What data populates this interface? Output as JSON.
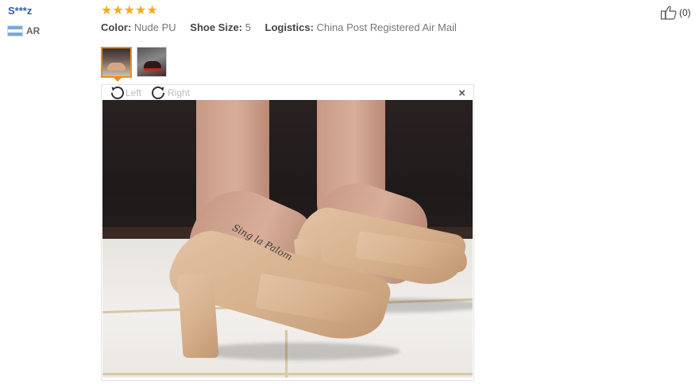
{
  "review": {
    "reviewer_name": "S***z",
    "country_code": "AR",
    "rating": 5,
    "rating_stars": [
      "★",
      "★",
      "★",
      "★",
      "★"
    ],
    "meta": [
      {
        "label": "Color:",
        "value": "Nude PU"
      },
      {
        "label": "Shoe Size:",
        "value": "5"
      },
      {
        "label": "Logistics:",
        "value": "China Post Registered Air Mail"
      }
    ],
    "helpful_count": "(0)"
  },
  "thumbnails": [
    {
      "name": "photo-thumb-1",
      "selected": true
    },
    {
      "name": "photo-thumb-2",
      "selected": false
    }
  ],
  "viewer": {
    "rotate_left_label": "Left",
    "rotate_right_label": "Right",
    "close_symbol": "×"
  },
  "photo": {
    "tattoo_text": "Sing la Paloma"
  },
  "icons": {
    "helpful": "thumbs-up-icon",
    "rotate_left": "rotate-left-icon",
    "rotate_right": "rotate-right-icon",
    "close": "close-icon",
    "flag": "argentina-flag-icon",
    "star": "star-icon"
  },
  "colors": {
    "star": "#f7a91b",
    "reviewer_link": "#2e5fa6",
    "thumb_selected_border": "#f28c1f"
  }
}
